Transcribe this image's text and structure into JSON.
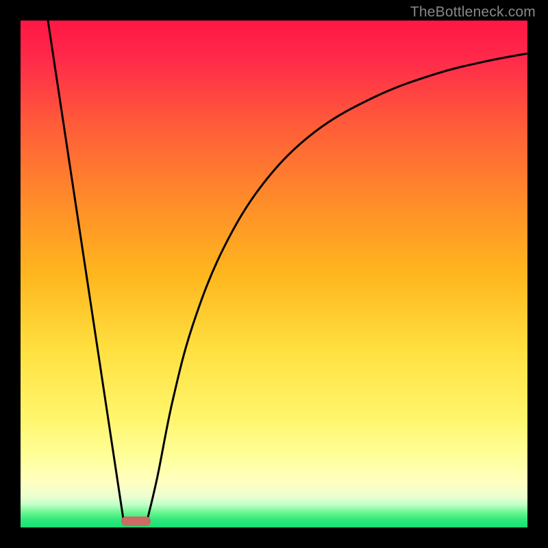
{
  "watermark": "TheBottleneck.com",
  "chart_data": {
    "type": "line",
    "title": "",
    "xlabel": "",
    "ylabel": "",
    "xlim": [
      0,
      100
    ],
    "ylim": [
      0,
      100
    ],
    "background_gradient": {
      "stops": [
        {
          "pos": 0.0,
          "color": "#ff1744"
        },
        {
          "pos": 0.08,
          "color": "#ff2b4a"
        },
        {
          "pos": 0.2,
          "color": "#ff5a3a"
        },
        {
          "pos": 0.35,
          "color": "#ff8a2a"
        },
        {
          "pos": 0.5,
          "color": "#ffb61e"
        },
        {
          "pos": 0.65,
          "color": "#ffe040"
        },
        {
          "pos": 0.78,
          "color": "#fff56a"
        },
        {
          "pos": 0.86,
          "color": "#ffff9a"
        },
        {
          "pos": 0.91,
          "color": "#ffffc0"
        },
        {
          "pos": 0.94,
          "color": "#eaffd0"
        },
        {
          "pos": 0.955,
          "color": "#c0ffc8"
        },
        {
          "pos": 0.97,
          "color": "#6cf790"
        },
        {
          "pos": 0.985,
          "color": "#2ee87c"
        },
        {
          "pos": 1.0,
          "color": "#18df74"
        }
      ]
    },
    "series": [
      {
        "name": "bottleneck-curve",
        "color": "#000000",
        "stroke_width": 3,
        "segments": [
          {
            "type": "line",
            "points": [
              {
                "x": 5.4,
                "y": 100
              },
              {
                "x": 20.3,
                "y": 1.5
              }
            ]
          },
          {
            "type": "curve",
            "points": [
              {
                "x": 25.0,
                "y": 1.5
              },
              {
                "x": 27.0,
                "y": 10
              },
              {
                "x": 30.0,
                "y": 25
              },
              {
                "x": 34.0,
                "y": 40
              },
              {
                "x": 40.0,
                "y": 55
              },
              {
                "x": 48.0,
                "y": 68
              },
              {
                "x": 58.0,
                "y": 78
              },
              {
                "x": 70.0,
                "y": 85
              },
              {
                "x": 82.0,
                "y": 89.5
              },
              {
                "x": 92.0,
                "y": 92
              },
              {
                "x": 100.0,
                "y": 93.5
              }
            ]
          }
        ]
      }
    ],
    "marker": {
      "x": 22.8,
      "y": 1.2,
      "width": 5.8,
      "height": 1.8,
      "color": "#cb6b63"
    }
  }
}
